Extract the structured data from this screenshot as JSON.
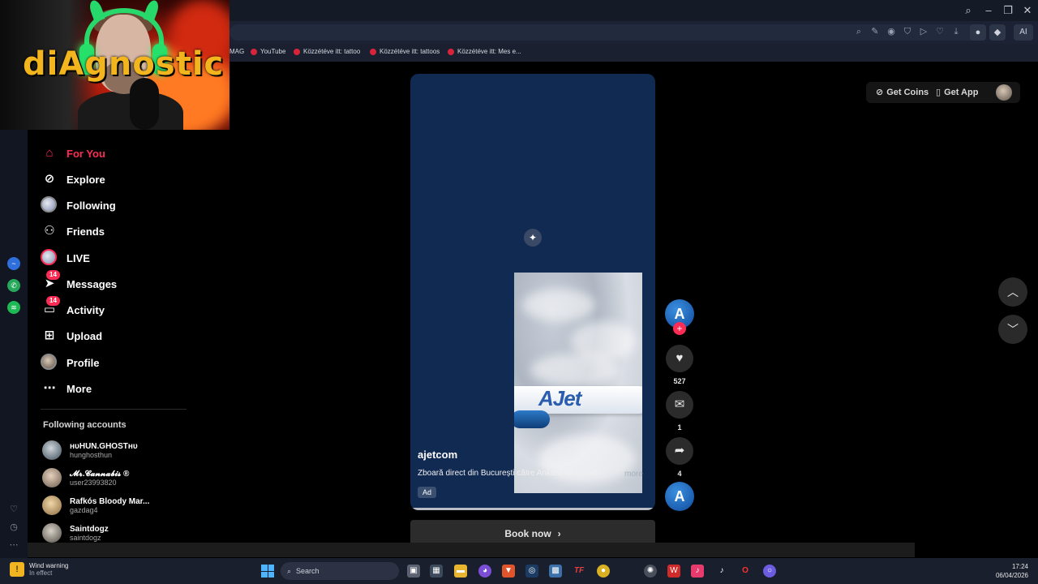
{
  "bookmarks": [
    {
      "label": "MAG",
      "icon": "bookmark-icon"
    },
    {
      "label": "YouTube",
      "icon": "youtube-icon"
    },
    {
      "label": "Közzétéve itt: tattoo",
      "icon": "pinterest-icon"
    },
    {
      "label": "Közzétéve itt: tattoos",
      "icon": "pinterest-icon"
    },
    {
      "label": "Közzétéve itt: Mes e...",
      "icon": "pinterest-icon"
    }
  ],
  "toolbar": {
    "ai_label": "AI"
  },
  "webcam": {
    "overlay_text": "diAgnostic"
  },
  "nav": {
    "items": [
      {
        "label": "For You",
        "icon": "home-icon",
        "active": true
      },
      {
        "label": "Explore",
        "icon": "compass-icon"
      },
      {
        "label": "Following",
        "icon": "avatar"
      },
      {
        "label": "Friends",
        "icon": "friends-icon"
      },
      {
        "label": "LIVE",
        "icon": "avatar"
      },
      {
        "label": "Messages",
        "icon": "send-icon",
        "badge": "14"
      },
      {
        "label": "Activity",
        "icon": "inbox-icon",
        "badge": "14"
      },
      {
        "label": "Upload",
        "icon": "plus-square-icon"
      },
      {
        "label": "Profile",
        "icon": "avatar"
      },
      {
        "label": "More",
        "icon": "more-icon"
      }
    ],
    "following_title": "Following accounts",
    "accounts": [
      {
        "name": "ʜᴜHUN.GHOSTʜᴜ",
        "user": "hunghosthun"
      },
      {
        "name": "𝓜𝓻.𝓒𝓪𝓷𝓷𝓪𝓫𝓲𝓼 ®",
        "user": "user23993820"
      },
      {
        "name": "Rafkós Bloody Mar...",
        "user": "gazdag4"
      },
      {
        "name": "Saintdogz",
        "user": "saintdogz"
      }
    ]
  },
  "video": {
    "author": "ajetcom",
    "description": "Zboară direct din București către Ankara de la 59$!",
    "more": "more",
    "ad_label": "Ad",
    "plane_logo": "AJet",
    "cta": "Book now"
  },
  "actions": {
    "likes": "527",
    "comments": "1",
    "shares": "4"
  },
  "topbar": {
    "get_coins": "Get Coins",
    "get_app": "Get App"
  },
  "taskbar": {
    "weather_title": "Wind warning",
    "weather_sub": "In effect",
    "search_placeholder": "Search",
    "time": "17:24",
    "date": "06/04/2026"
  },
  "colors": {
    "accent": "#fe2c55",
    "video_bg": "#112a52",
    "jet_blue": "#2a5dae"
  }
}
